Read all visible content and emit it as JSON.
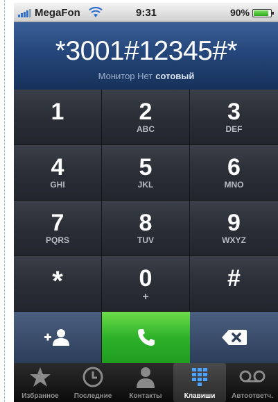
{
  "status_bar": {
    "carrier": "MegaFon",
    "time": "9:31",
    "battery": "90%",
    "battery_level": 0.9
  },
  "display": {
    "number": "*3001#12345#*",
    "label_monitor": "Монитор Нет",
    "label_type": "сотовый"
  },
  "keypad": [
    {
      "digit": "1",
      "letters": ""
    },
    {
      "digit": "2",
      "letters": "ABC"
    },
    {
      "digit": "3",
      "letters": "DEF"
    },
    {
      "digit": "4",
      "letters": "GHI"
    },
    {
      "digit": "5",
      "letters": "JKL"
    },
    {
      "digit": "6",
      "letters": "MNO"
    },
    {
      "digit": "7",
      "letters": "PQRS"
    },
    {
      "digit": "8",
      "letters": "TUV"
    },
    {
      "digit": "9",
      "letters": "WXYZ"
    },
    {
      "digit": "*",
      "letters": ""
    },
    {
      "digit": "0",
      "letters": "+"
    },
    {
      "digit": "#",
      "letters": ""
    }
  ],
  "actions": {
    "add_contact_icon": "add-contact-icon",
    "call_icon": "phone-icon",
    "delete_icon": "backspace-icon"
  },
  "colors": {
    "call_green": "#2eb12a",
    "display_blue": "#25467a",
    "keypad_dark": "#2a2e36"
  },
  "tabs": [
    {
      "label": "Избранное",
      "icon": "star-icon",
      "active": false
    },
    {
      "label": "Последние",
      "icon": "clock-icon",
      "active": false
    },
    {
      "label": "Контакты",
      "icon": "person-icon",
      "active": false
    },
    {
      "label": "Клавиши",
      "icon": "keypad-grid-icon",
      "active": true
    },
    {
      "label": "Автоответч.",
      "icon": "voicemail-icon",
      "active": false
    }
  ]
}
